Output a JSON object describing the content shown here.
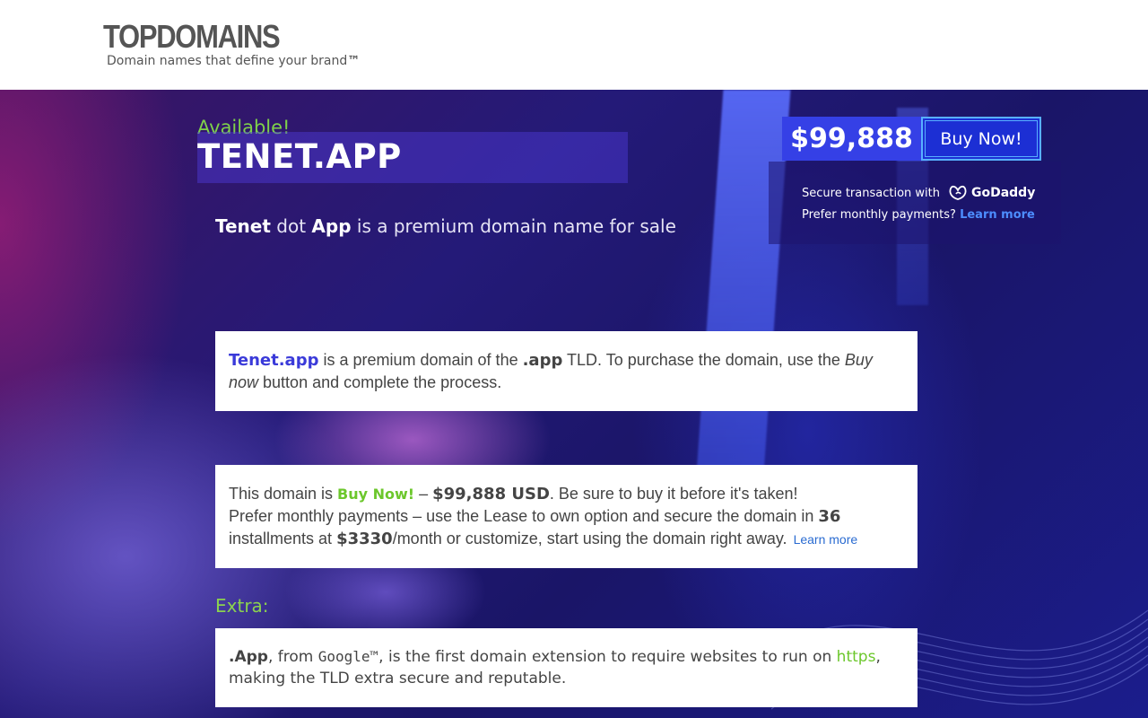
{
  "header": {
    "logo": "TOPDOMAINS",
    "tagline": "Domain names that define your brand",
    "tagline_tm": "™"
  },
  "hero": {
    "available": "Available!",
    "domain": "TENET.APP",
    "tagline_name": "Tenet",
    "tagline_dot": " dot ",
    "tagline_tld": "App",
    "tagline_rest": " is a premium domain name for sale"
  },
  "pricing": {
    "price": "$99,888",
    "buy_label": "Buy Now!",
    "secure_text": "Secure transaction with",
    "provider": "GoDaddy",
    "monthly_text": "Prefer monthly payments?",
    "learn_more": "Learn more"
  },
  "card1": {
    "domain": "Tenet.app",
    "t1": " is a premium domain of the ",
    "tld": ".app",
    "t2": " TLD. To purchase the domain, use the ",
    "buy_now": "Buy now",
    "t3": " button and complete the process."
  },
  "card2": {
    "t1": "This domain is ",
    "buy": "Buy Now!",
    "t2": " – ",
    "price": "$99,888 USD",
    "t3": ". Be sure to buy it before it's taken!",
    "t4": "Prefer monthly payments – use the Lease to own option and secure the domain in ",
    "installments": "36",
    "t5": "installments at ",
    "monthly": "$3330",
    "t6": "/month or customize, start using the domain right away.",
    "learn_more": "Learn more"
  },
  "extra": {
    "heading": "Extra:",
    "tld": ".App",
    "t1": ", from ",
    "brand": "Google™",
    "t2": ", is the first domain extension to require websites to run on ",
    "https": "https",
    "t3": ", making the TLD extra secure and reputable."
  },
  "colors": {
    "accent_green": "#7fd24a",
    "price_blue": "#3540e6",
    "link_blue": "#2a6bd1"
  }
}
